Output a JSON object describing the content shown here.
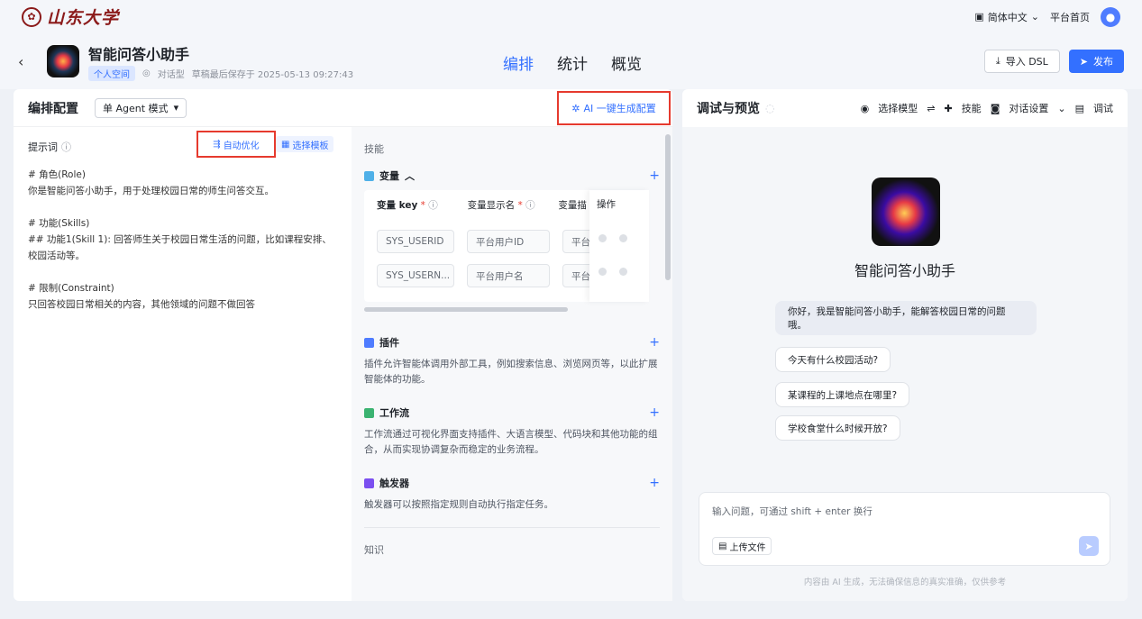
{
  "topbar": {
    "logo_text": "山东大学",
    "language": "简体中文",
    "home_link": "平台首页"
  },
  "header": {
    "app_title": "智能问答小助手",
    "space_tag": "个人空间",
    "app_type": "对话型",
    "draft_status": "草稿最后保存于 2025-05-13 09:27:43",
    "tabs": [
      "编排",
      "统计",
      "概览"
    ],
    "active_tab": "编排",
    "import_dsl": "导入 DSL",
    "publish": "发布"
  },
  "config": {
    "title": "编排配置",
    "mode": "单 Agent 模式",
    "ai_generate": "AI 一键生成配置",
    "prompt_label": "提示词",
    "auto_optimize": "自动优化",
    "select_template": "选择模板",
    "prompt_text": "# 角色(Role)\n你是智能问答小助手，用于处理校园日常的师生问答交互。\n\n# 功能(Skills)\n## 功能1(Skill 1): 回答师生关于校园日常生活的问题，比如课程安排、校园活动等。\n\n# 限制(Constraint)\n只回答校园日常相关的内容，其他领域的问题不做回答"
  },
  "skills": {
    "section_label": "技能",
    "variables": {
      "title": "变量",
      "col_key": "变量 key",
      "col_display": "变量显示名",
      "col_desc": "变量描",
      "col_ops": "操作",
      "rows": [
        {
          "key": "SYS_USERID",
          "display": "平台用户ID",
          "desc": "平台"
        },
        {
          "key": "SYS_USERN...",
          "display": "平台用户名",
          "desc": "平台"
        }
      ]
    },
    "plugins": {
      "title": "插件",
      "desc": "插件允许智能体调用外部工具，例如搜索信息、浏览网页等，以此扩展智能体的功能。"
    },
    "workflow": {
      "title": "工作流",
      "desc": "工作流通过可视化界面支持插件、大语言模型、代码块和其他功能的组合，从而实现协调复杂而稳定的业务流程。"
    },
    "trigger": {
      "title": "触发器",
      "desc": "触发器可以按照指定规则自动执行指定任务。"
    },
    "knowledge_label": "知识"
  },
  "preview": {
    "title": "调试与预览",
    "select_model": "选择模型",
    "skills": "技能",
    "chat_settings": "对话设置",
    "debug": "调试",
    "bot_name": "智能问答小助手",
    "greeting": "你好，我是智能问答小助手，能解答校园日常的问题哦。",
    "suggestions": [
      "今天有什么校园活动?",
      "某课程的上课地点在哪里?",
      "学校食堂什么时候开放?"
    ],
    "input_placeholder": "输入问题，可通过 shift + enter 换行",
    "upload": "上传文件",
    "footnote": "内容由 AI 生成，无法确保信息的真实准确，仅供参考"
  },
  "colors": {
    "accent": "#3370ff",
    "highlight_border": "#e63a2e",
    "brand": "#8b1a1a"
  }
}
